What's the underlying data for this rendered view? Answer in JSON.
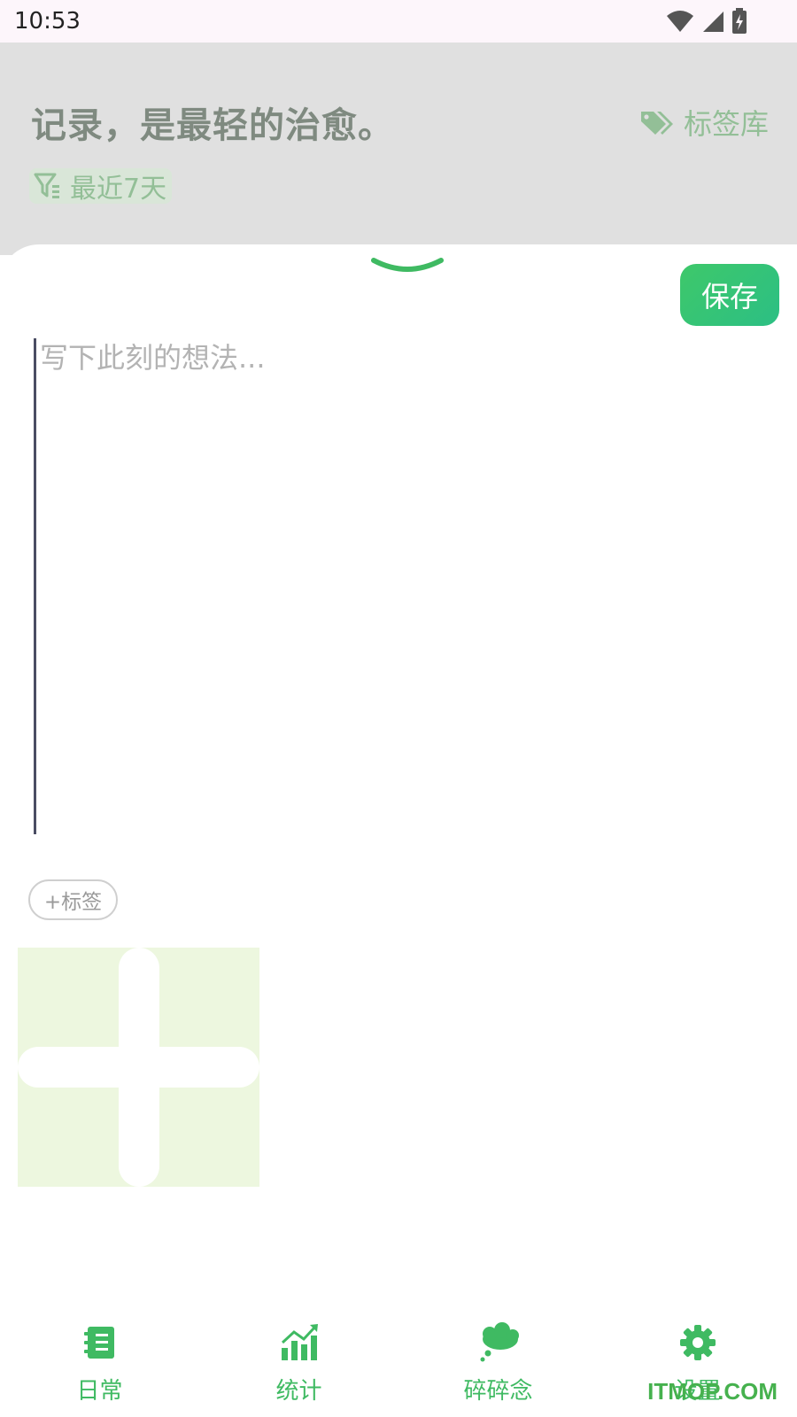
{
  "status_bar": {
    "time": "10:53"
  },
  "header": {
    "slogan": "记录，是最轻的治愈。",
    "tag_library_label": "标签库",
    "filter_label": "最近7天"
  },
  "sheet": {
    "save_label": "保存",
    "note_placeholder": "写下此刻的想法...",
    "add_tag_label": "+标签"
  },
  "nav": {
    "items": [
      {
        "label": "日常",
        "icon": "notebook-icon"
      },
      {
        "label": "统计",
        "icon": "bar-chart-icon"
      },
      {
        "label": "碎碎念",
        "icon": "thought-cloud-icon"
      },
      {
        "label": "设置",
        "icon": "gear-icon"
      }
    ],
    "active_index": 0
  },
  "watermark": "ITMOP.COM",
  "colors": {
    "accent": "#3fba62",
    "save_gradient_start": "#3ec86a",
    "save_gradient_end": "#2cbf84",
    "dim_overlay": "#e0e0e0",
    "image_placeholder": "#edf7df"
  }
}
